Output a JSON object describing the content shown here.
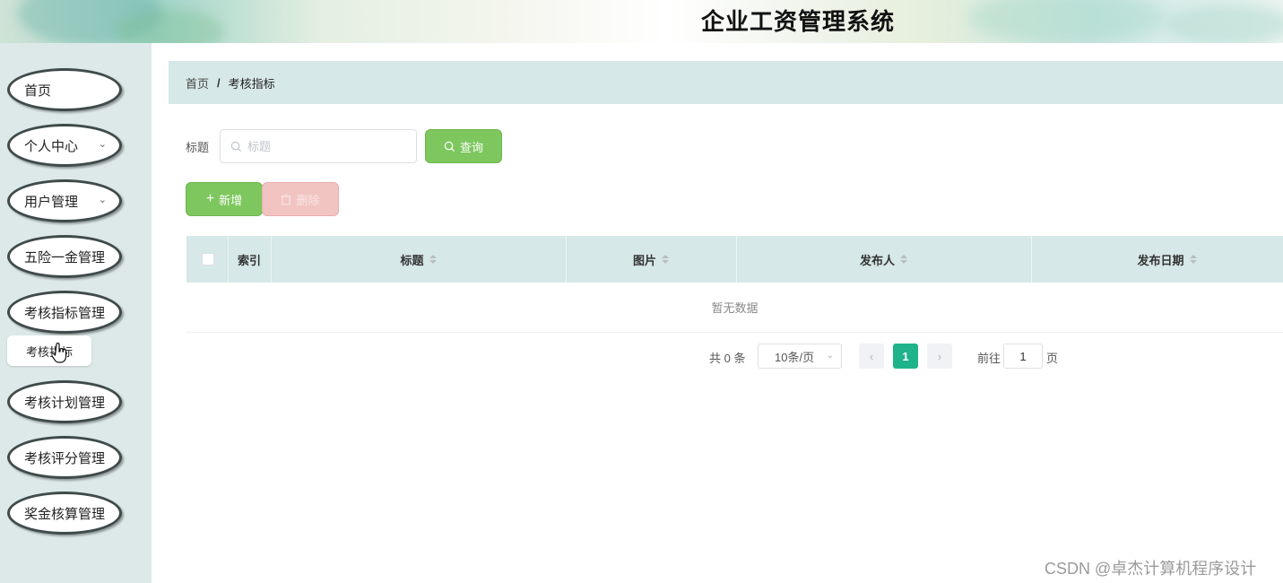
{
  "app": {
    "title": "企业工资管理系统"
  },
  "sidebar": {
    "items": [
      {
        "label": "首页",
        "expandable": false
      },
      {
        "label": "个人中心",
        "expandable": true
      },
      {
        "label": "用户管理",
        "expandable": true
      },
      {
        "label": "五险一金管理",
        "expandable": false
      },
      {
        "label": "考核指标管理",
        "expandable": false
      },
      {
        "label": "考核计划管理",
        "expandable": false
      },
      {
        "label": "考核评分管理",
        "expandable": false
      },
      {
        "label": "奖金核算管理",
        "expandable": false
      }
    ],
    "sub_item": {
      "label": "考核指标"
    }
  },
  "breadcrumb": {
    "home": "首页",
    "separator": "/",
    "current": "考核指标"
  },
  "search": {
    "label": "标题",
    "placeholder": "标题",
    "value": "",
    "query_button": "查询"
  },
  "actions": {
    "add_label": "新增",
    "delete_label": "删除"
  },
  "table": {
    "columns": [
      "索引",
      "标题",
      "图片",
      "发布人",
      "发布日期"
    ],
    "rows": [],
    "empty_text": "暂无数据"
  },
  "pagination": {
    "total_text": "共 0 条",
    "page_size": "10条/页",
    "current_page": "1",
    "goto_label": "前往",
    "goto_value": "1",
    "page_suffix": "页"
  },
  "watermark": "CSDN @卓杰计算机程序设计",
  "colors": {
    "primary_green": "#7ec75e",
    "delete_pink": "#f1c4c2",
    "active_page": "#1fb38a",
    "table_head": "#d6e8e7"
  }
}
